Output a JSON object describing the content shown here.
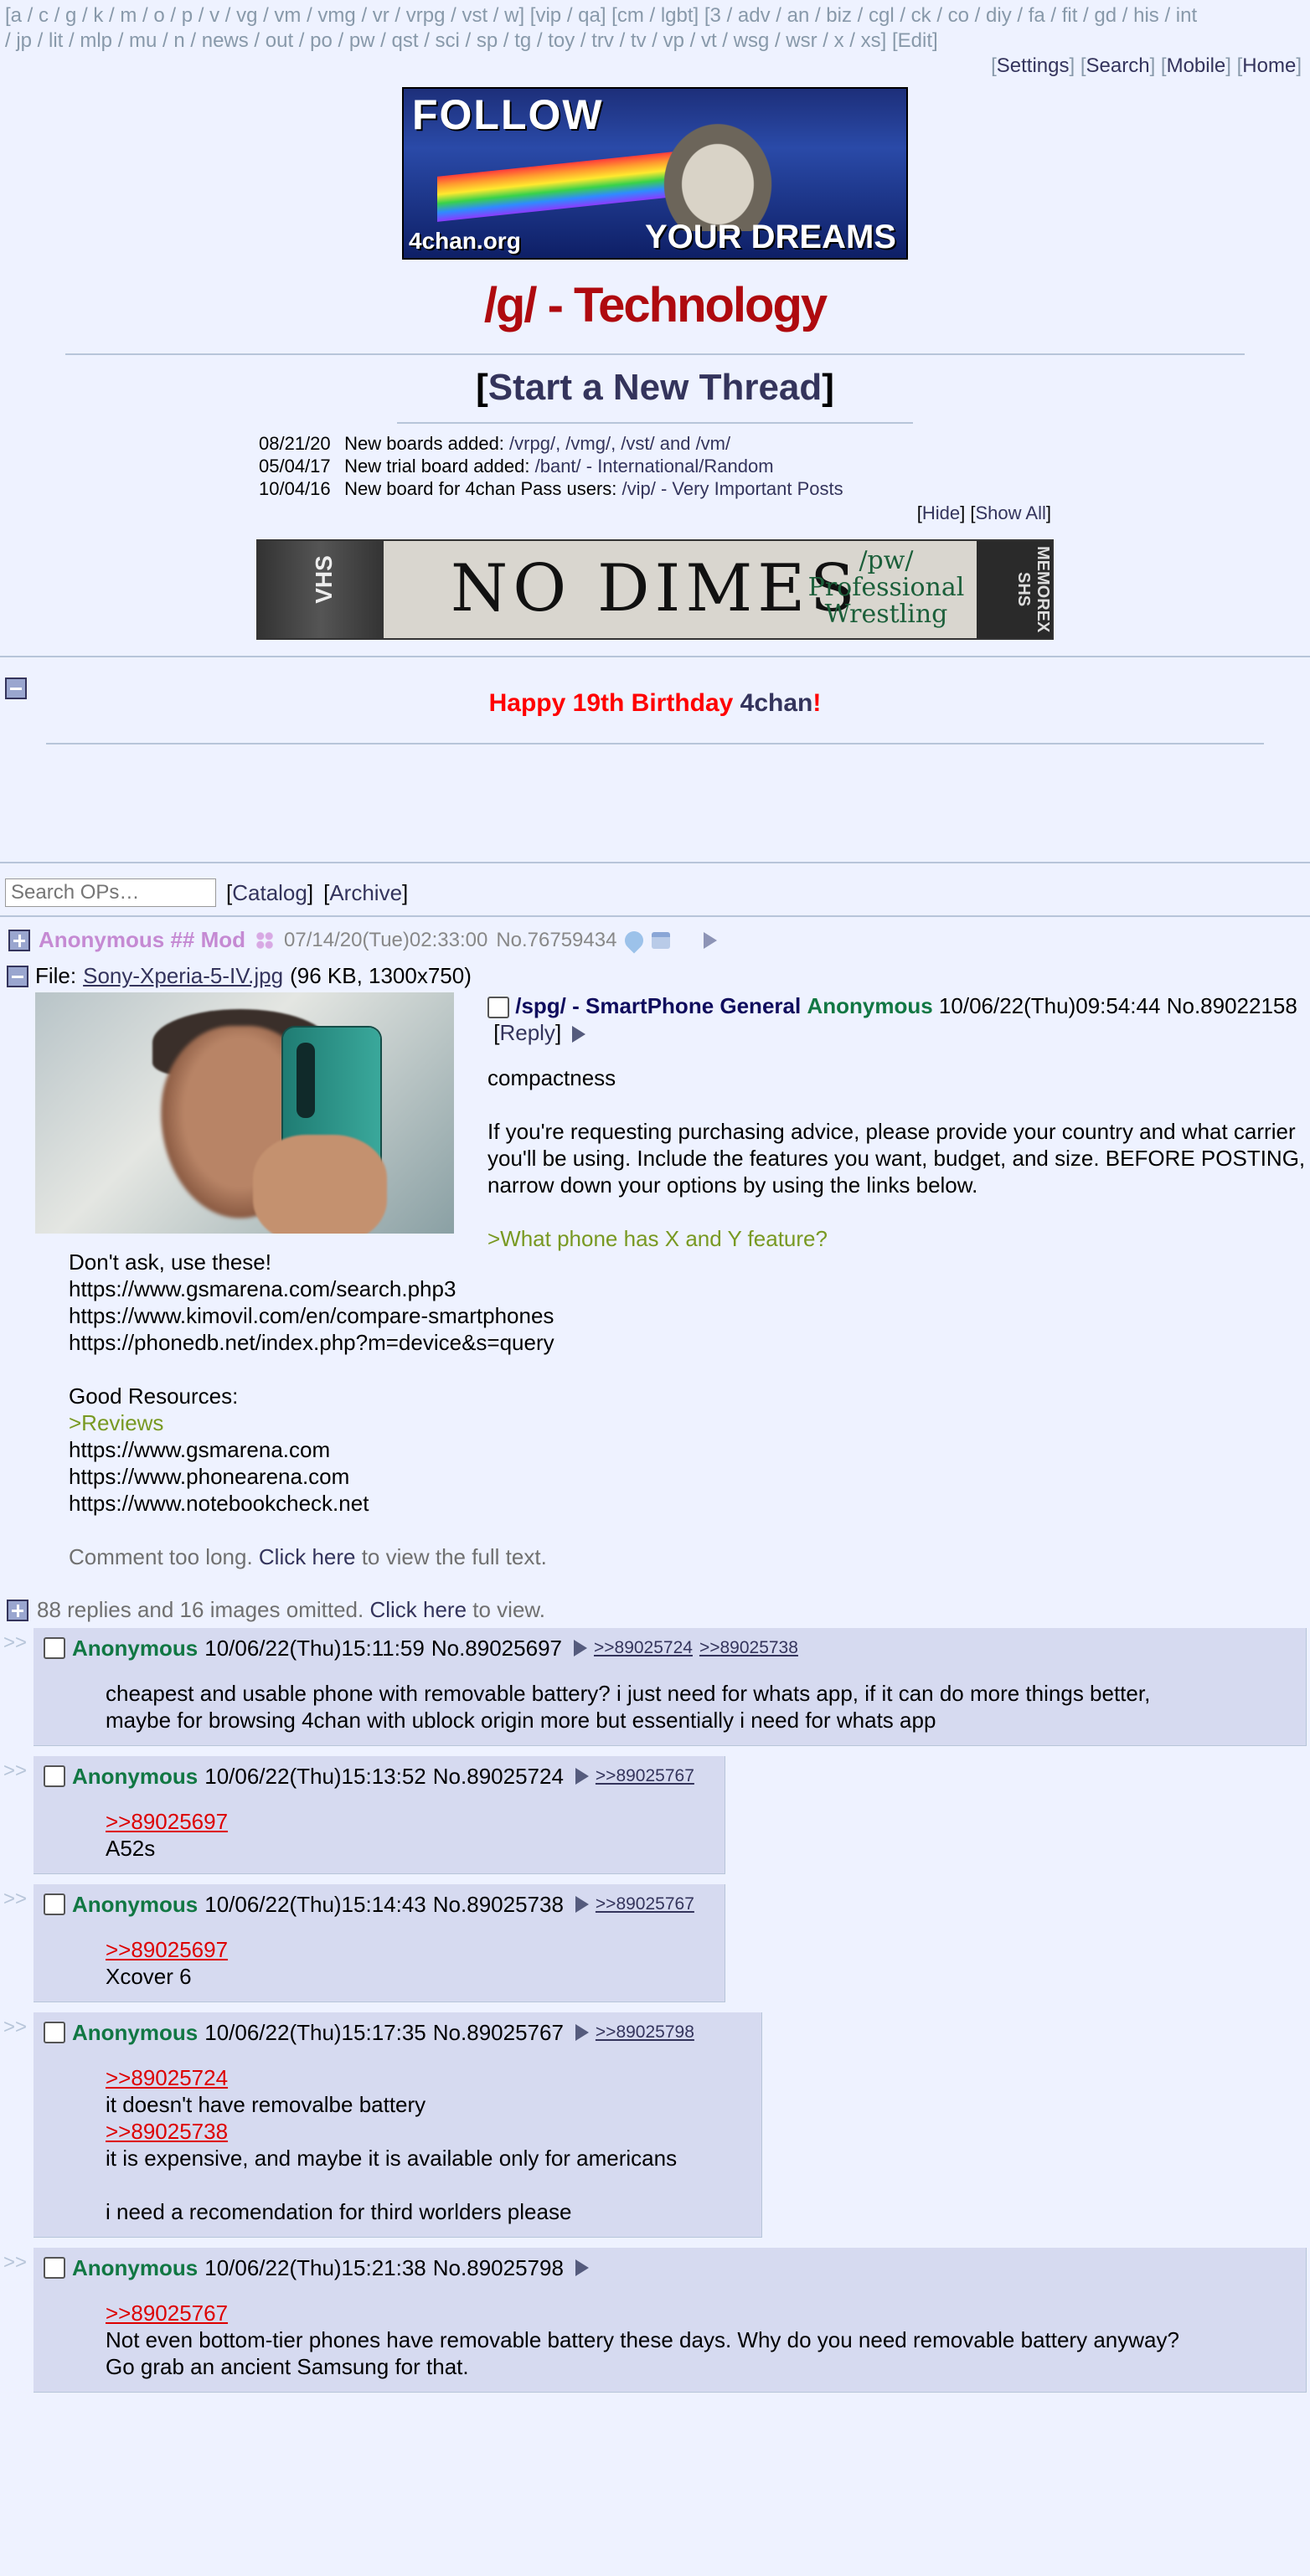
{
  "boardnav": {
    "line1": "[a / c / g / k / m / o / p / v / vg / vm / vmg / vr / vrpg / vst / w] [vip / qa] [cm / lgbt] [3 / adv / an / biz / cgl / ck / co / diy / fa / fit / gd / his / int",
    "line2": "/ jp / lit / mlp / mu / n / news / out / po / pw / qst / sci / sp / tg / toy / trv / tv / vp / vt / wsg / wsr / x / xs] [Edit]"
  },
  "toplinks": [
    "Settings",
    "Search",
    "Mobile",
    "Home"
  ],
  "banner": {
    "follow": "FOLLOW",
    "dreams": "YOUR DREAMS",
    "site": "4chan.org"
  },
  "board_title": "/g/ - Technology",
  "new_thread": "Start a New Thread",
  "news": [
    {
      "date": "08/21/20",
      "text": "New boards added:",
      "links": "/vrpg/, /vmg/, /vst/ and /vm/"
    },
    {
      "date": "05/04/17",
      "text": "New trial board added:",
      "links": "/bant/ - International/Random"
    },
    {
      "date": "10/04/16",
      "text": "New board for 4chan Pass users:",
      "links": "/vip/ - Very Important Posts"
    }
  ],
  "news_ctrl": {
    "hide": "Hide",
    "show_all": "Show All"
  },
  "ad": {
    "main": "NO DIMES",
    "side": "/pw/ Professional Wrestling",
    "vhs_left": "VHS",
    "vhs_right": "MEMOREX SHS"
  },
  "announcement": {
    "part1": "Happy 19th Birthday ",
    "part2": "4chan",
    "part3": "!"
  },
  "search": {
    "placeholder": "Search OPs…",
    "catalog": "Catalog",
    "archive": "Archive"
  },
  "sticky": {
    "name": "Anonymous ## Mod",
    "datetime": "07/14/20(Tue)02:33:00",
    "no": "No.76759434"
  },
  "op": {
    "file_label": "File:",
    "file_name": "Sony-Xperia-5-IV.jpg",
    "file_meta": "(96 KB, 1300x750)",
    "subject": "/spg/ - SmartPhone General",
    "name": "Anonymous",
    "datetime": "10/06/22(Thu)09:54:44",
    "no": "No.89022158",
    "reply_link": "Reply",
    "lines": [
      "compactness",
      "If you're requesting purchasing advice, please provide your country and what carrier you'll be using. Include the features you want, budget, and size. BEFORE POSTING, narrow down your options by using the links below.",
      ">What phone has X and Y feature?"
    ],
    "more": [
      [
        "Don't ask, use these!",
        "https://www.gsmarena.com/search.php3",
        "https://www.kimovil.com/en/compare-smartphones",
        "https://phonedb.net/index.php?m=device&s=query"
      ],
      [
        "Good Resources:",
        ">Reviews",
        "https://www.gsmarena.com",
        "https://www.phonearena.com",
        "https://www.notebookcheck.net"
      ]
    ],
    "abbr": {
      "pre": "Comment too long. ",
      "link": "Click here",
      "post": " to view the full text."
    }
  },
  "omitted": {
    "text": "88 replies and 16 images omitted. ",
    "link": "Click here",
    "post": " to view."
  },
  "replies": [
    {
      "name": "Anonymous",
      "datetime": "10/06/22(Thu)15:11:59",
      "no": "No.89025697",
      "backlinks": [
        ">>89025724",
        ">>89025738"
      ],
      "quotes": [],
      "lines": [
        "cheapest and usable phone with removable battery? i just need for whats app, if it can do more things better,",
        "maybe for browsing 4chan with ublock origin more but essentially i need for whats app"
      ]
    },
    {
      "name": "Anonymous",
      "datetime": "10/06/22(Thu)15:13:52",
      "no": "No.89025724",
      "backlinks": [
        ">>89025767"
      ],
      "quotes": [
        ">>89025697"
      ],
      "lines": [
        "A52s"
      ]
    },
    {
      "name": "Anonymous",
      "datetime": "10/06/22(Thu)15:14:43",
      "no": "No.89025738",
      "backlinks": [
        ">>89025767"
      ],
      "quotes": [
        ">>89025697"
      ],
      "lines": [
        "Xcover 6"
      ]
    },
    {
      "name": "Anonymous",
      "datetime": "10/06/22(Thu)15:17:35",
      "no": "No.89025767",
      "backlinks": [
        ">>89025798"
      ],
      "body": [
        [
          ">>89025724",
          "it doesn't have removalbe battery"
        ],
        [
          ">>89025738",
          "it is expensive, and maybe it is available only for americans"
        ],
        [
          "",
          ""
        ],
        [
          "",
          "i need a recomendation for third worlders please"
        ]
      ]
    },
    {
      "name": "Anonymous",
      "datetime": "10/06/22(Thu)15:21:38",
      "no": "No.89025798",
      "backlinks": [],
      "quotes": [
        ">>89025767"
      ],
      "lines": [
        "Not even bottom-tier phones have removable battery these days. Why do you need removable battery anyway?",
        "Go grab an ancient Samsung for that."
      ]
    }
  ],
  "side_marker": ">>"
}
